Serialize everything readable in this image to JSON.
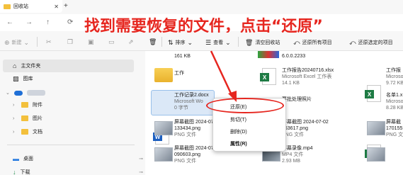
{
  "window": {
    "tab_title": "回收站"
  },
  "annotation": {
    "headline": "找到需要恢复的文件，点击“还原”"
  },
  "toolbar": {
    "new_label": "新建",
    "sort_label": "排序",
    "view_label": "查看",
    "empty_label": "清空回收站",
    "restore_all_label": "还原所有项目",
    "restore_selected_label": "还原选定的项目"
  },
  "sidebar": {
    "items": [
      {
        "label": "主文件夹"
      },
      {
        "label": "图库"
      },
      {
        "label": "附件"
      },
      {
        "label": "图片"
      },
      {
        "label": "文档"
      },
      {
        "label": "桌面"
      },
      {
        "label": "下载"
      }
    ]
  },
  "files": {
    "top_size": "161 KB",
    "top_partial": "6.0.0.2233",
    "folder_name": "工作",
    "excel1_name": "工作报告20240716.xlsx",
    "excel1_type": "Microsoft Excel 工作表",
    "excel1_size": "14.1 KB",
    "right_excel_name": "工作报",
    "right_excel_type": "Microso",
    "right_excel_size": "9.72 KB",
    "word_name": "工作记录2.docx",
    "word_type": "Microsoft Wo",
    "word_size": "0 字节",
    "middle_partial": "要批处理照片",
    "list_name": "名单1.x",
    "list_type": "Microso",
    "list_size": "8.28 KB",
    "shot1_name": "屏幕截图 2024-07-",
    "shot1_sub": "133434.png",
    "shot1_type": "PNG 文件",
    "shot2_name": "屏幕截图 2024-07-02",
    "shot2_sub": "163617.png",
    "shot2_type": "PNG 文件",
    "shot_right_name": "屏幕截",
    "shot_right_sub": "170155",
    "shot_right_type": "PNG 文",
    "shot3_name": "屏幕截图 2024-07-",
    "shot3_sub": "090603.png",
    "shot3_type": "PNG 文件",
    "video_name": "屏幕录像.mp4",
    "video_type": "MP4 文件",
    "video_size": "2.93 MB"
  },
  "context_menu": {
    "items": [
      {
        "label": "还原(E)"
      },
      {
        "label": "剪切(T)"
      },
      {
        "label": "删除(D)"
      },
      {
        "label": "属性(R)"
      }
    ]
  },
  "colors": {
    "annotation_red": "#e6261f",
    "selection_blue": "#dbe8f7",
    "folder_yellow": "#f3c03c"
  }
}
